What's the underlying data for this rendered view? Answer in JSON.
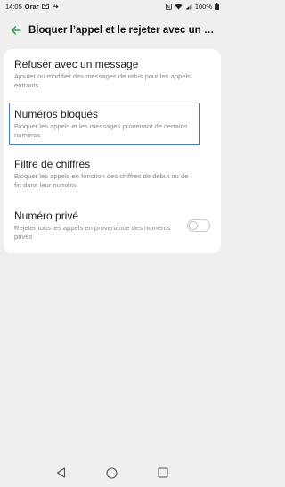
{
  "status_bar": {
    "time": "14:05",
    "carrier": "Orar",
    "battery": "100%",
    "icons": [
      "mail-icon",
      "usb-icon",
      "nfc-icon",
      "wifi-icon",
      "signal-icon",
      "battery-icon"
    ]
  },
  "app_bar": {
    "title": "Bloquer l’appel et le rejeter avec un message"
  },
  "settings": {
    "items": [
      {
        "title": "Refuser avec un message",
        "description": "Ajouter ou modifier des messages de refus pour les appels entrants"
      },
      {
        "title": "Numéros bloqués",
        "description": "Bloquer les appels et les messages provenant de certains numéros"
      },
      {
        "title": "Filtre de chiffres",
        "description": "Bloquer les appels en fonction des chiffres de début ou de fin dans leur numéro"
      },
      {
        "title": "Numéro privé",
        "description": "Rejeter tous les appels en provenance des numéros privés",
        "toggle_on": false
      }
    ]
  },
  "colors": {
    "accent": "#2e9b4f",
    "highlight": "#4a78c9",
    "background": "#efefef"
  }
}
